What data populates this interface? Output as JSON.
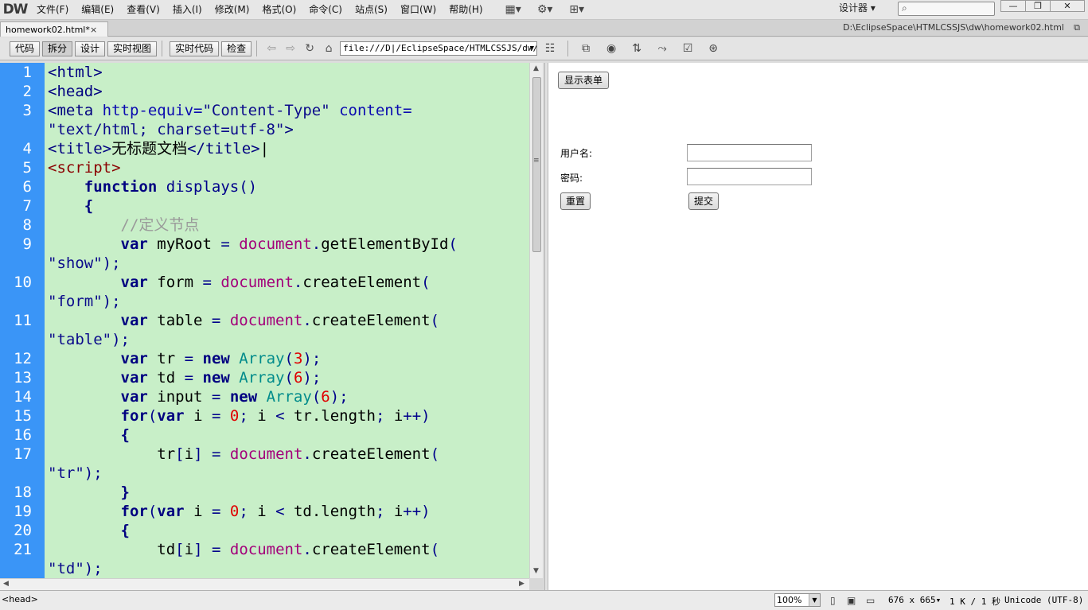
{
  "app": {
    "logo": "DW"
  },
  "menu": [
    "文件(F)",
    "编辑(E)",
    "查看(V)",
    "插入(I)",
    "修改(M)",
    "格式(O)",
    "命令(C)",
    "站点(S)",
    "窗口(W)",
    "帮助(H)"
  ],
  "menubar_icons": [
    "layout-icon",
    "gear-icon",
    "sitemap-icon"
  ],
  "workspace": {
    "label": "设计器 ▾"
  },
  "window_buttons": {
    "minimize": "—",
    "restore": "❐",
    "close": "✕"
  },
  "document": {
    "tab": "homework02.html*",
    "close": "×",
    "path": "D:\\EclipseSpace\\HTMLCSSJS\\dw\\homework02.html"
  },
  "toolbar": {
    "code": "代码",
    "split": "拆分",
    "design": "设计",
    "live_view": "实时视图",
    "live_code": "实时代码",
    "inspect": "检查",
    "url": "file:///D|/EclipseSpace/HTMLCSSJS/dw/h"
  },
  "code_lines": [
    {
      "n": "1",
      "segs": [
        [
          "tg",
          "<html>"
        ]
      ]
    },
    {
      "n": "2",
      "segs": [
        [
          "tg",
          "<head>"
        ]
      ]
    },
    {
      "n": "3",
      "segs": [
        [
          "tg",
          "<meta "
        ],
        [
          "at",
          "http-equiv="
        ],
        [
          "st",
          "\"Content-Type\""
        ],
        [
          "tx",
          " "
        ],
        [
          "at",
          "content="
        ]
      ]
    },
    {
      "n": "",
      "segs": [
        [
          "st",
          "\"text/html; charset=utf-8\""
        ],
        [
          "tg",
          ">"
        ]
      ]
    },
    {
      "n": "4",
      "segs": [
        [
          "tg",
          "<title>"
        ],
        [
          "tx",
          "无标题文档"
        ],
        [
          "tg",
          "</title>"
        ],
        [
          "tx",
          "|"
        ]
      ]
    },
    {
      "n": "5",
      "segs": [
        [
          "sc",
          "<script>"
        ]
      ]
    },
    {
      "n": "6",
      "segs": [
        [
          "tx",
          "    "
        ],
        [
          "k",
          "function"
        ],
        [
          "tx",
          " "
        ],
        [
          "ps",
          "displays()"
        ]
      ]
    },
    {
      "n": "7",
      "segs": [
        [
          "tx",
          "    "
        ],
        [
          "k",
          "{"
        ]
      ]
    },
    {
      "n": "8",
      "segs": [
        [
          "tx",
          "        "
        ],
        [
          "cm",
          "//定义节点"
        ]
      ]
    },
    {
      "n": "9",
      "segs": [
        [
          "tx",
          "        "
        ],
        [
          "k",
          "var"
        ],
        [
          "tx",
          " myRoot "
        ],
        [
          "ps",
          "="
        ],
        [
          "tx",
          " "
        ],
        [
          "dm",
          "document"
        ],
        [
          "ps",
          "."
        ],
        [
          "tx",
          "getElementById"
        ],
        [
          "ps",
          "("
        ]
      ]
    },
    {
      "n": "",
      "segs": [
        [
          "st",
          "\"show\""
        ],
        [
          "ps",
          ");"
        ]
      ]
    },
    {
      "n": "10",
      "segs": [
        [
          "tx",
          "        "
        ],
        [
          "k",
          "var"
        ],
        [
          "tx",
          " form "
        ],
        [
          "ps",
          "="
        ],
        [
          "tx",
          " "
        ],
        [
          "dm",
          "document"
        ],
        [
          "ps",
          "."
        ],
        [
          "tx",
          "createElement"
        ],
        [
          "ps",
          "("
        ]
      ]
    },
    {
      "n": "",
      "segs": [
        [
          "st",
          "\"form\""
        ],
        [
          "ps",
          ");"
        ]
      ]
    },
    {
      "n": "11",
      "segs": [
        [
          "tx",
          "        "
        ],
        [
          "k",
          "var"
        ],
        [
          "tx",
          " table "
        ],
        [
          "ps",
          "="
        ],
        [
          "tx",
          " "
        ],
        [
          "dm",
          "document"
        ],
        [
          "ps",
          "."
        ],
        [
          "tx",
          "createElement"
        ],
        [
          "ps",
          "("
        ]
      ]
    },
    {
      "n": "",
      "segs": [
        [
          "st",
          "\"table\""
        ],
        [
          "ps",
          ");"
        ]
      ]
    },
    {
      "n": "12",
      "segs": [
        [
          "tx",
          "        "
        ],
        [
          "k",
          "var"
        ],
        [
          "tx",
          " tr "
        ],
        [
          "ps",
          "="
        ],
        [
          "tx",
          " "
        ],
        [
          "k",
          "new"
        ],
        [
          "tx",
          " "
        ],
        [
          "ar",
          "Array"
        ],
        [
          "ps",
          "("
        ],
        [
          "nm",
          "3"
        ],
        [
          "ps",
          ");"
        ]
      ]
    },
    {
      "n": "13",
      "segs": [
        [
          "tx",
          "        "
        ],
        [
          "k",
          "var"
        ],
        [
          "tx",
          " td "
        ],
        [
          "ps",
          "="
        ],
        [
          "tx",
          " "
        ],
        [
          "k",
          "new"
        ],
        [
          "tx",
          " "
        ],
        [
          "ar",
          "Array"
        ],
        [
          "ps",
          "("
        ],
        [
          "nm",
          "6"
        ],
        [
          "ps",
          ");"
        ]
      ]
    },
    {
      "n": "14",
      "segs": [
        [
          "tx",
          "        "
        ],
        [
          "k",
          "var"
        ],
        [
          "tx",
          " input "
        ],
        [
          "ps",
          "="
        ],
        [
          "tx",
          " "
        ],
        [
          "k",
          "new"
        ],
        [
          "tx",
          " "
        ],
        [
          "ar",
          "Array"
        ],
        [
          "ps",
          "("
        ],
        [
          "nm",
          "6"
        ],
        [
          "ps",
          ");"
        ]
      ]
    },
    {
      "n": "15",
      "segs": [
        [
          "tx",
          "        "
        ],
        [
          "k",
          "for"
        ],
        [
          "ps",
          "("
        ],
        [
          "k",
          "var"
        ],
        [
          "tx",
          " i "
        ],
        [
          "ps",
          "="
        ],
        [
          "tx",
          " "
        ],
        [
          "nm",
          "0"
        ],
        [
          "ps",
          ";"
        ],
        [
          "tx",
          " i "
        ],
        [
          "ps",
          "<"
        ],
        [
          "tx",
          " tr.length"
        ],
        [
          "ps",
          ";"
        ],
        [
          "tx",
          " i"
        ],
        [
          "ps",
          "++)"
        ]
      ]
    },
    {
      "n": "16",
      "segs": [
        [
          "tx",
          "        "
        ],
        [
          "k",
          "{"
        ]
      ]
    },
    {
      "n": "17",
      "segs": [
        [
          "tx",
          "            tr"
        ],
        [
          "ps",
          "["
        ],
        [
          "tx",
          "i"
        ],
        [
          "ps",
          "]"
        ],
        [
          "tx",
          " "
        ],
        [
          "ps",
          "="
        ],
        [
          "tx",
          " "
        ],
        [
          "dm",
          "document"
        ],
        [
          "ps",
          "."
        ],
        [
          "tx",
          "createElement"
        ],
        [
          "ps",
          "("
        ]
      ]
    },
    {
      "n": "",
      "segs": [
        [
          "st",
          "\"tr\""
        ],
        [
          "ps",
          ");"
        ]
      ]
    },
    {
      "n": "18",
      "segs": [
        [
          "tx",
          "        "
        ],
        [
          "k",
          "}"
        ]
      ]
    },
    {
      "n": "19",
      "segs": [
        [
          "tx",
          "        "
        ],
        [
          "k",
          "for"
        ],
        [
          "ps",
          "("
        ],
        [
          "k",
          "var"
        ],
        [
          "tx",
          " i "
        ],
        [
          "ps",
          "="
        ],
        [
          "tx",
          " "
        ],
        [
          "nm",
          "0"
        ],
        [
          "ps",
          ";"
        ],
        [
          "tx",
          " i "
        ],
        [
          "ps",
          "<"
        ],
        [
          "tx",
          " td.length"
        ],
        [
          "ps",
          ";"
        ],
        [
          "tx",
          " i"
        ],
        [
          "ps",
          "++)"
        ]
      ]
    },
    {
      "n": "20",
      "segs": [
        [
          "tx",
          "        "
        ],
        [
          "k",
          "{"
        ]
      ]
    },
    {
      "n": "21",
      "segs": [
        [
          "tx",
          "            td"
        ],
        [
          "ps",
          "["
        ],
        [
          "tx",
          "i"
        ],
        [
          "ps",
          "]"
        ],
        [
          "tx",
          " "
        ],
        [
          "ps",
          "="
        ],
        [
          "tx",
          " "
        ],
        [
          "dm",
          "document"
        ],
        [
          "ps",
          "."
        ],
        [
          "tx",
          "createElement"
        ],
        [
          "ps",
          "("
        ]
      ]
    },
    {
      "n": "",
      "segs": [
        [
          "st",
          "\"td\""
        ],
        [
          "ps",
          ");"
        ]
      ]
    }
  ],
  "design": {
    "show_form_button": "显示表单",
    "username_label": "用户名:",
    "password_label": "密码:",
    "reset_button": "重置",
    "submit_button": "提交"
  },
  "status": {
    "tag": "<head>",
    "zoom": "100%",
    "size": "676 x 665▾",
    "download": "1 K / 1 秒",
    "encoding": "Unicode (UTF-8)"
  }
}
